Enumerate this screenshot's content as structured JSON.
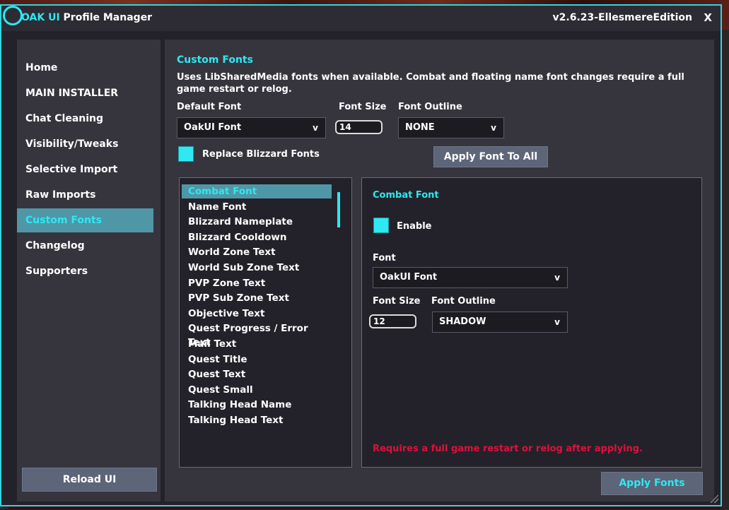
{
  "window": {
    "title_brand": "OAK UI",
    "title_rest": " Profile Manager",
    "version": "v2.6.23-EllesmereEdition",
    "close_label": "X"
  },
  "edge_tab": "ta",
  "sidebar": {
    "items": [
      {
        "label": "Home"
      },
      {
        "label": "MAIN INSTALLER"
      },
      {
        "label": "Chat Cleaning"
      },
      {
        "label": "Visibility/Tweaks"
      },
      {
        "label": "Selective Import"
      },
      {
        "label": "Raw Imports"
      },
      {
        "label": "Custom Fonts",
        "active": true
      },
      {
        "label": "Changelog"
      },
      {
        "label": "Supporters"
      }
    ],
    "reload_label": "Reload UI"
  },
  "custom_fonts": {
    "title": "Custom Fonts",
    "description": "Uses LibSharedMedia fonts when available. Combat and floating name font changes require a full game restart or relog.",
    "default_font_label": "Default Font",
    "default_font_value": "OakUI Font",
    "font_size_label": "Font Size",
    "font_size_value": "14",
    "font_outline_label": "Font Outline",
    "font_outline_value": "NONE",
    "dropdown_arrow": "v",
    "replace_blizzard_label": "Replace Blizzard Fonts",
    "replace_blizzard_checked": true,
    "apply_all_label": "Apply Font To All",
    "list": [
      "Combat Font",
      "Name Font",
      "Blizzard Nameplate",
      "Blizzard Cooldown",
      "World Zone Text",
      "World Sub Zone Text",
      "PVP Zone Text",
      "PVP Sub Zone Text",
      "Objective Text",
      "Quest Progress / Error Text",
      "Mail Text",
      "Quest Title",
      "Quest Text",
      "Quest Small",
      "Talking Head Name",
      "Talking Head Text"
    ],
    "selected_index": 0,
    "detail": {
      "title": "Combat Font",
      "enable_label": "Enable",
      "enable_checked": true,
      "font_label": "Font",
      "font_value": "OakUI Font",
      "font_size_label": "Font Size",
      "font_size_value": "12",
      "font_outline_label": "Font Outline",
      "font_outline_value": "SHADOW",
      "warning": "Requires a full game restart or relog after applying."
    },
    "apply_fonts_label": "Apply Fonts"
  },
  "colors": {
    "accent": "#2ee8f2",
    "active_bg": "#4f97a7",
    "warning": "#e0103c",
    "button_bg": "#5d6579"
  }
}
